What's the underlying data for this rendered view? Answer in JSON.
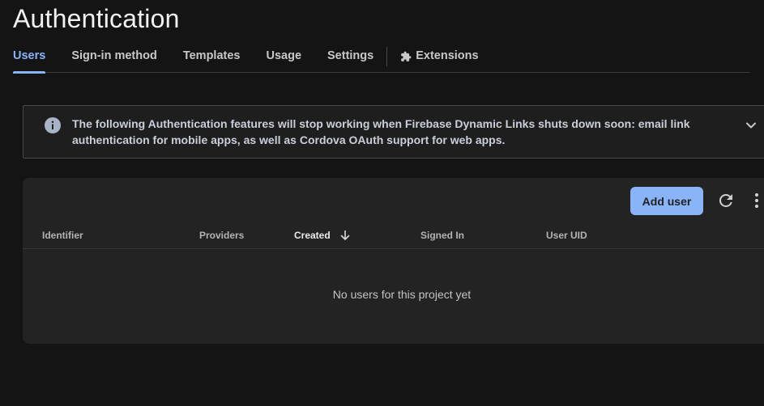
{
  "page": {
    "title": "Authentication"
  },
  "tabs": [
    {
      "label": "Users",
      "active": true
    },
    {
      "label": "Sign-in method",
      "active": false
    },
    {
      "label": "Templates",
      "active": false
    },
    {
      "label": "Usage",
      "active": false
    },
    {
      "label": "Settings",
      "active": false
    },
    {
      "label": "Extensions",
      "active": false,
      "icon": "extension-puzzle-icon"
    }
  ],
  "banner": {
    "icon": "info-icon",
    "text": "The following Authentication features will stop working when Firebase Dynamic Links shuts down soon: email link authentication for mobile apps, as well as Cordova OAuth support for web apps.",
    "expand_icon": "chevron-down-icon"
  },
  "users_table": {
    "add_user_label": "Add user",
    "refresh_icon": "refresh-icon",
    "more_icon": "more-vert-icon",
    "columns": [
      {
        "label": "Identifier"
      },
      {
        "label": "Providers"
      },
      {
        "label": "Created",
        "sorted": "descending",
        "sort_icon": "arrow-down-icon"
      },
      {
        "label": "Signed In"
      },
      {
        "label": "User UID"
      }
    ],
    "empty_message": "No users for this project yet"
  },
  "colors": {
    "accent": "#8ab4f8",
    "background": "#141414",
    "card": "#232323"
  }
}
